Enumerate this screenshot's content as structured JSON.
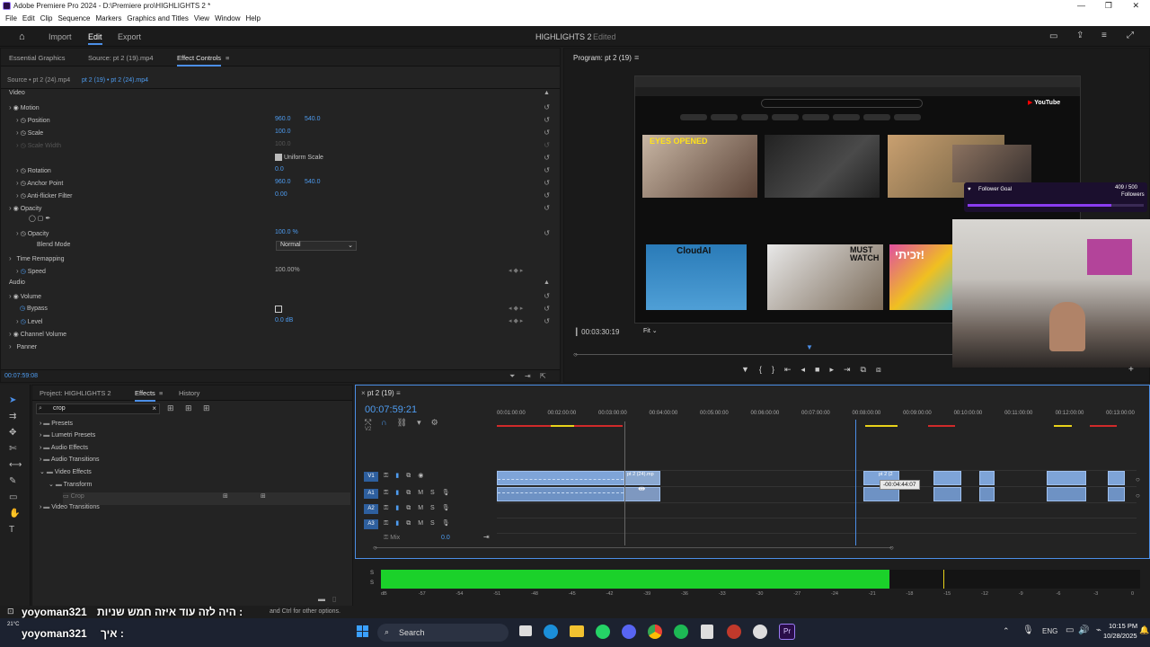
{
  "window": {
    "title": "Adobe Premiere Pro 2024 - D:\\Premiere pro\\HIGHLIGHTS 2 *",
    "controls": [
      "—",
      "❐",
      "✕"
    ]
  },
  "menu": [
    "File",
    "Edit",
    "Clip",
    "Sequence",
    "Markers",
    "Graphics and Titles",
    "View",
    "Window",
    "Help"
  ],
  "workspace": {
    "tabs": [
      "Import",
      "Edit",
      "Export"
    ],
    "active": "Edit",
    "project_title": "HIGHLIGHTS 2",
    "status": "Edited"
  },
  "effect_panel": {
    "tabs": [
      "Essential Graphics",
      "Source: pt 2 (19).mp4",
      "Effect Controls"
    ],
    "source_label": "Source • pt 2 (24).mp4",
    "clip_label": "pt 2 (19) • pt 2 (24).mp4",
    "video_header": "Video",
    "audio_header": "Audio",
    "rows": [
      {
        "label": "Motion",
        "v1": "",
        "v2": ""
      },
      {
        "label": "Position",
        "v1": "960.0",
        "v2": "540.0"
      },
      {
        "label": "Scale",
        "v1": "100.0",
        "v2": ""
      },
      {
        "label": "Scale Width",
        "v1": "100.0",
        "v2": ""
      },
      {
        "label": "Uniform Scale",
        "v1": "",
        "v2": ""
      },
      {
        "label": "Rotation",
        "v1": "0.0",
        "v2": ""
      },
      {
        "label": "Anchor Point",
        "v1": "960.0",
        "v2": "540.0"
      },
      {
        "label": "Anti-flicker Filter",
        "v1": "0.00",
        "v2": ""
      },
      {
        "label": "Opacity",
        "v1": "",
        "v2": ""
      },
      {
        "label": "Opacity",
        "v1": "100.0 %",
        "v2": ""
      },
      {
        "label": "Blend Mode",
        "v1": "Normal",
        "v2": ""
      },
      {
        "label": "Time Remapping",
        "v1": "",
        "v2": ""
      },
      {
        "label": "Speed",
        "v1": "100.00%",
        "v2": ""
      },
      {
        "label": "Volume",
        "v1": "",
        "v2": ""
      },
      {
        "label": "Bypass",
        "v1": "",
        "v2": ""
      },
      {
        "label": "Level",
        "v1": "0.0 dB",
        "v2": ""
      },
      {
        "label": "Channel Volume",
        "v1": "",
        "v2": ""
      },
      {
        "label": "Panner",
        "v1": "",
        "v2": ""
      }
    ],
    "timecode": "00:07:59:08"
  },
  "program": {
    "title": "Program: pt 2 (19)",
    "timecode": "00:03:30:19",
    "fit": "Fit"
  },
  "screen": {
    "video_titles": [
      "EYES OPENED",
      "CloudAI",
      "MUST WATCH",
      "זכיתי!"
    ],
    "youtube_label": "YouTube",
    "follower_goal": "Follower Goal",
    "follower_count": "409 / 500",
    "follower_unit": "Followers"
  },
  "project_panel": {
    "tabs": [
      "Project: HIGHLIGHTS 2",
      "Effects",
      "History"
    ],
    "search_value": "crop",
    "tree": [
      "Presets",
      "Lumetri Presets",
      "Audio Effects",
      "Audio Transitions",
      "Video Effects",
      "Transform",
      "Crop",
      "Video Transitions"
    ]
  },
  "timeline": {
    "title": "pt 2 (19)",
    "timecode": "00:07:59:21",
    "ruler": [
      "00:01:00:00",
      "00:02:00:00",
      "00:03:00:00",
      "00:04:00:00",
      "00:05:00:00",
      "00:06:00:00",
      "00:07:00:00",
      "00:08:00:00",
      "00:09:00:00",
      "00:10:00:00",
      "00:11:00:00",
      "00:12:00:00",
      "00:13:00:00"
    ],
    "tracks": [
      "V2",
      "V1",
      "A1",
      "A2",
      "A3"
    ],
    "mix_label": "Mix",
    "mix_value": "0.0",
    "clip_name": "pt 2 (24).mp",
    "tooltip": "-00:04:44:07",
    "playhead_fraction": 0.56
  },
  "meter": {
    "ticks": [
      "dB",
      "-57",
      "-54",
      "-51",
      "-48",
      "-45",
      "-42",
      "-39",
      "-36",
      "-33",
      "-30",
      "-27",
      "-24",
      "-21",
      "-18",
      "-15",
      "-12",
      "-9",
      "-6",
      "-3",
      "0"
    ],
    "channels": [
      "S",
      "S"
    ],
    "level_fraction": 0.67
  },
  "chat": {
    "line1_user": "yoyoman321",
    "line1_msg": ": היה לזה עוד איזה חמש שניות",
    "line2_user": "yoyoman321",
    "line2_msg": ": איך",
    "hint": "and Ctrl for other options."
  },
  "taskbar": {
    "search": "Search",
    "lang": "ENG",
    "time": "10:15 PM",
    "date": "10/28/2025",
    "weather": "21°C"
  }
}
